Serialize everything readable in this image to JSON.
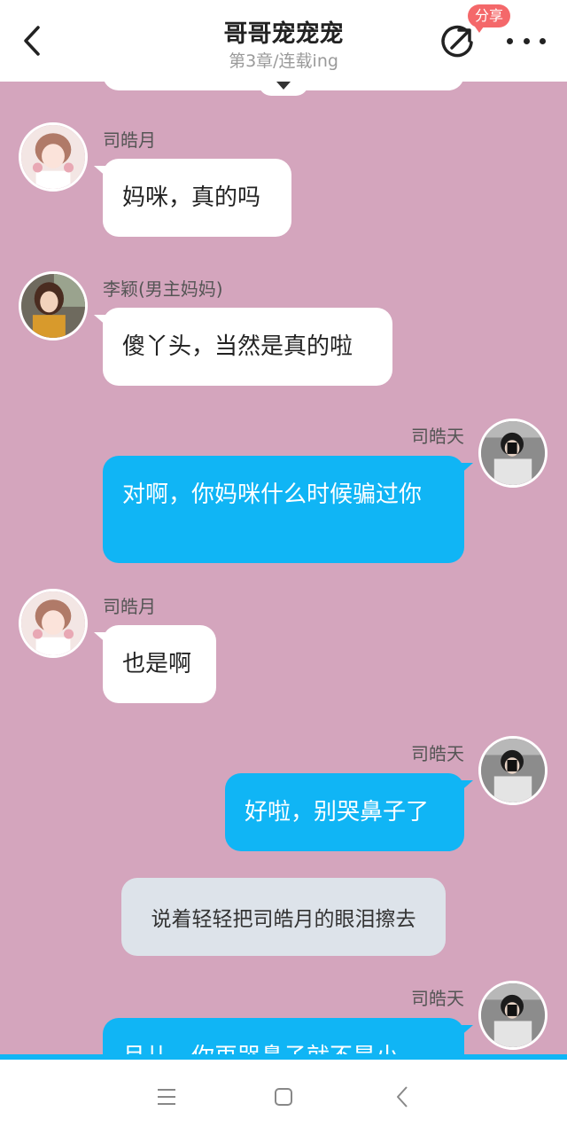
{
  "header": {
    "title": "哥哥宠宠宠",
    "subtitle": "第3章/连载ing",
    "share_badge": "分享",
    "back_icon": "chevron-left-icon",
    "share_icon": "share-arrow-icon",
    "more_icon": "more-dots-icon"
  },
  "messages": [
    {
      "side": "left",
      "name": "司皓月",
      "text": "妈咪，真的吗",
      "avatar": "girl-pink-avatar"
    },
    {
      "side": "left",
      "name": "李颖(男主妈妈)",
      "text": "傻丫头，当然是真的啦",
      "avatar": "woman-avatar"
    },
    {
      "side": "right",
      "name": "司皓天",
      "text": "对啊，你妈咪什么时候骗过你",
      "avatar": "boy-mirror-avatar"
    },
    {
      "side": "left",
      "name": "司皓月",
      "text": "也是啊",
      "avatar": "girl-pink-avatar"
    },
    {
      "side": "right",
      "name": "司皓天",
      "text": "好啦，别哭鼻子了",
      "avatar": "boy-mirror-avatar"
    },
    {
      "side": "narration",
      "text": "说着轻轻把司皓月的眼泪擦去"
    },
    {
      "side": "right",
      "name": "司皓天",
      "text": "月儿，你再哭鼻子就不是小",
      "avatar": "boy-mirror-avatar"
    }
  ],
  "colors": {
    "chat_background": "#d4a5bd",
    "right_bubble": "#10b5f5",
    "left_bubble": "#ffffff",
    "narration_bubble": "#dde3ea",
    "badge": "#f4686a"
  },
  "navbar": {
    "menu_icon": "menu-icon",
    "home_icon": "home-square-icon",
    "back_icon": "back-triangle-icon"
  }
}
